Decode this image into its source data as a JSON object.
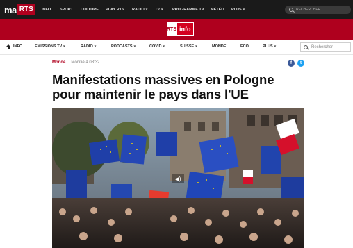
{
  "brand": {
    "prefix": "ma",
    "logo": "RTS"
  },
  "global_nav": [
    {
      "label": "INFO",
      "dropdown": false
    },
    {
      "label": "SPORT",
      "dropdown": false
    },
    {
      "label": "CULTURE",
      "dropdown": false
    },
    {
      "label": "PLAY RTS",
      "dropdown": false
    },
    {
      "label": "RADIO",
      "dropdown": true
    },
    {
      "label": "TV",
      "dropdown": true
    },
    {
      "label": "PROGRAMME TV",
      "dropdown": false
    },
    {
      "label": "MÉTÉO",
      "dropdown": false
    },
    {
      "label": "PLUS",
      "dropdown": true
    }
  ],
  "global_search": {
    "placeholder": "RECHERCHER"
  },
  "info_logo": {
    "rts": "RTS",
    "info": "info"
  },
  "sub_nav": [
    {
      "label": "INFO",
      "dropdown": false,
      "home": true
    },
    {
      "label": "EMISSIONS TV",
      "dropdown": true
    },
    {
      "label": "RADIO",
      "dropdown": true
    },
    {
      "label": "PODCASTS",
      "dropdown": true
    },
    {
      "label": "COVID",
      "dropdown": true
    },
    {
      "label": "SUISSE",
      "dropdown": true
    },
    {
      "label": "MONDE",
      "dropdown": false
    },
    {
      "label": "ECO",
      "dropdown": false
    },
    {
      "label": "PLUS",
      "dropdown": true
    }
  ],
  "sub_search": {
    "placeholder": "Rechercher"
  },
  "article": {
    "category": "Monde",
    "modified": "Modifié à 08:32",
    "title": "Manifestations massives en Pologne pour maintenir le pays dans l'UE"
  },
  "colors": {
    "brand_red": "#af001e",
    "facebook": "#3b5998",
    "twitter": "#1da1f2"
  },
  "icons": {
    "share_facebook": "f",
    "share_twitter": "t",
    "audio": "speaker-icon"
  }
}
